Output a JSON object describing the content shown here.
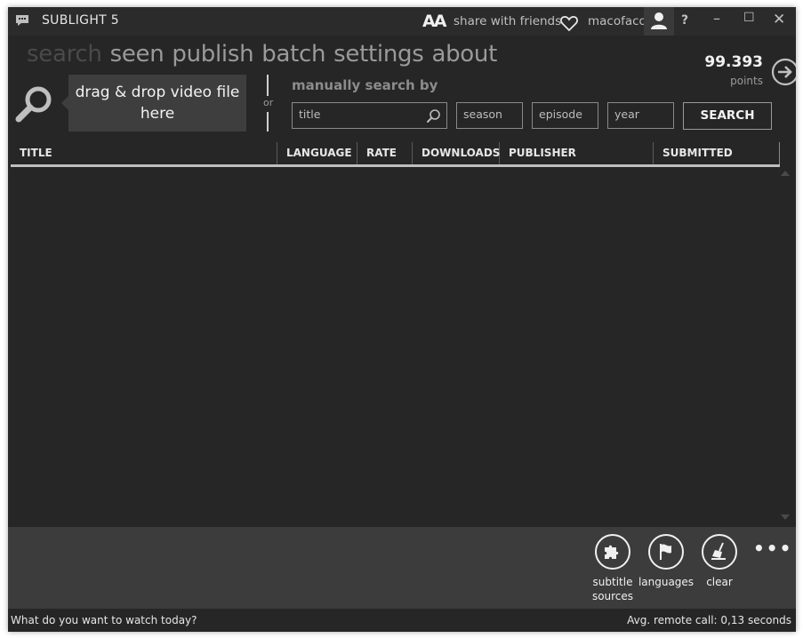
{
  "app": {
    "title": "SUBLIGHT 5"
  },
  "titlebar": {
    "font_toggle": "AA",
    "share": "share with friends",
    "username": "macofaco",
    "help": "?",
    "minimize": "–",
    "maximize": "☐",
    "close": "✕"
  },
  "nav": {
    "tabs": [
      {
        "label": "search",
        "active": true
      },
      {
        "label": "seen"
      },
      {
        "label": "publish"
      },
      {
        "label": "batch"
      },
      {
        "label": "settings"
      },
      {
        "label": "about"
      }
    ]
  },
  "points": {
    "value": "99.393",
    "label": "points"
  },
  "drop": {
    "line1": "drag & drop video file",
    "line2": "here",
    "or": "or"
  },
  "manual": {
    "label": "manually search by",
    "title_placeholder": "title",
    "season_placeholder": "season",
    "episode_placeholder": "episode",
    "year_placeholder": "year",
    "search_button": "SEARCH"
  },
  "table": {
    "columns": [
      "TITLE",
      "LANGUAGE",
      "RATE",
      "DOWNLOADS",
      "PUBLISHER",
      "SUBMITTED"
    ]
  },
  "appbar": {
    "subtitle_sources_1": "subtitle",
    "subtitle_sources_2": "sources",
    "languages": "languages",
    "clear": "clear",
    "more": "•••"
  },
  "status": {
    "left": "What do you want to watch today?",
    "right": "Avg. remote call: 0,13 seconds"
  }
}
